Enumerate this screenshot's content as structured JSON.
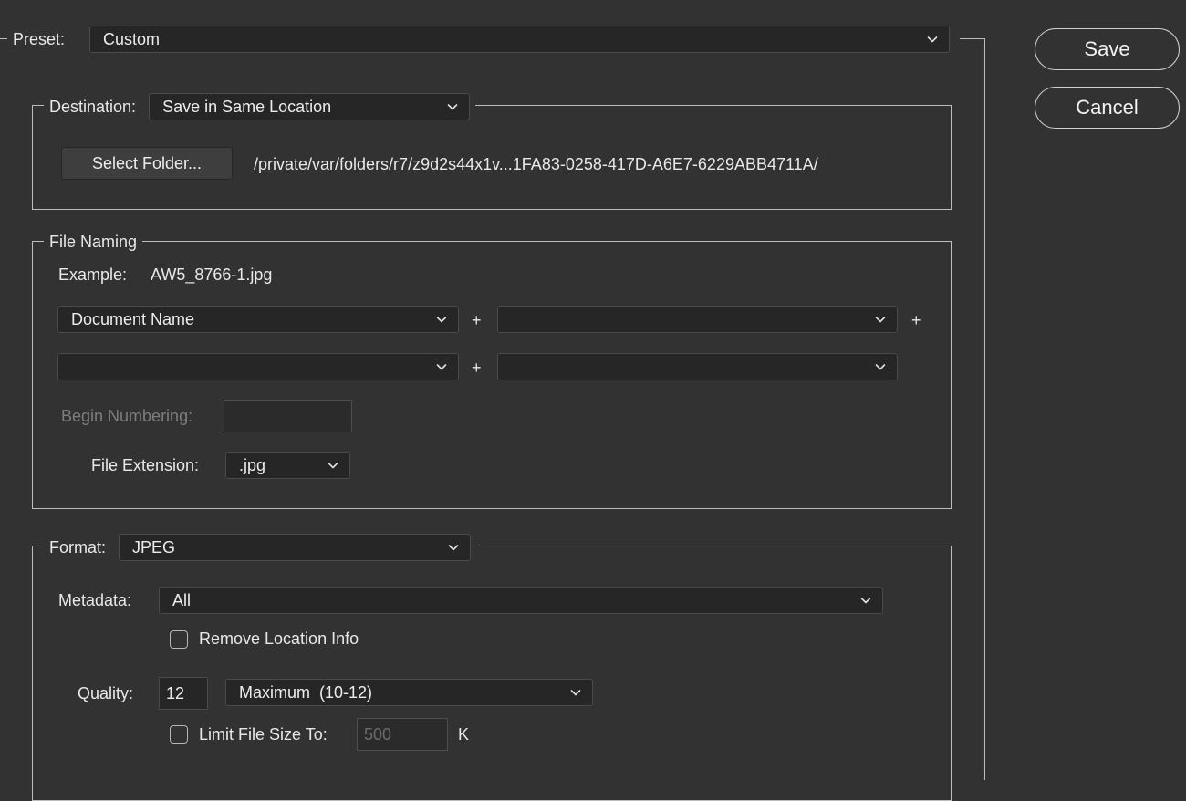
{
  "preset": {
    "label": "Preset:",
    "value": "Custom"
  },
  "buttons": {
    "save": "Save",
    "cancel": "Cancel"
  },
  "destination": {
    "label": "Destination:",
    "value": "Save in Same Location",
    "select_folder": "Select Folder...",
    "path": "/private/var/folders/r7/z9d2s44x1v...1FA83-0258-417D-A6E7-6229ABB4711A/"
  },
  "file_naming": {
    "title": "File Naming",
    "example_label": "Example:",
    "example_value": "AW5_8766-1.jpg",
    "fields": [
      "Document Name",
      "",
      "",
      ""
    ],
    "plus": "+",
    "begin_numbering_label": "Begin Numbering:",
    "begin_numbering_value": "",
    "extension_label": "File Extension:",
    "extension_value": ".jpg"
  },
  "format": {
    "label": "Format:",
    "value": "JPEG",
    "metadata_label": "Metadata:",
    "metadata_value": "All",
    "remove_location_label": "Remove Location Info",
    "remove_location_checked": false,
    "quality_label": "Quality:",
    "quality_value": "12",
    "quality_preset": "Maximum  (10-12)",
    "limit_size_label": "Limit File Size To:",
    "limit_size_checked": false,
    "limit_size_placeholder": "500",
    "limit_size_unit": "K"
  },
  "icons": {
    "dropdown": "chevron-down-icon",
    "checkbox": "checkbox-icon"
  },
  "colors": {
    "background": "#323232",
    "field_background": "#262626",
    "border": "#bdbdbd",
    "disabled_text": "#7d7d7d"
  }
}
